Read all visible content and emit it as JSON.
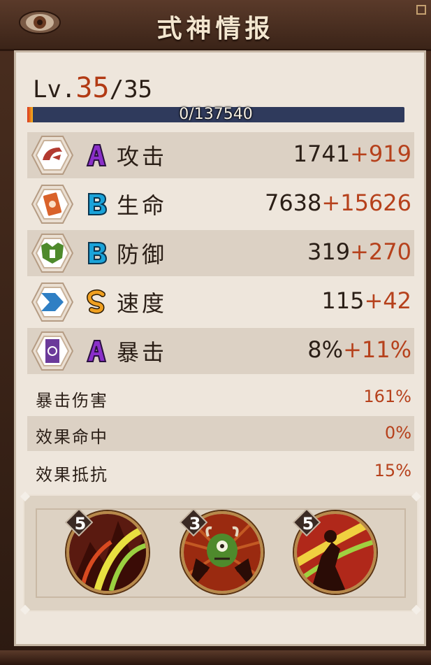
{
  "header": {
    "title": "式神情报"
  },
  "level": {
    "prefix": "Lv.",
    "current": "35",
    "max": "/35"
  },
  "xp": {
    "text": "0/137540",
    "fraction": 0
  },
  "stats": [
    {
      "name": "攻击",
      "grade": "A",
      "base": "1741",
      "bonus": "+919",
      "icon": "attack-icon"
    },
    {
      "name": "生命",
      "grade": "B",
      "base": "7638",
      "bonus": "+15626",
      "icon": "health-icon"
    },
    {
      "name": "防御",
      "grade": "B",
      "base": "319",
      "bonus": "+270",
      "icon": "defense-icon"
    },
    {
      "name": "速度",
      "grade": "S",
      "base": "115",
      "bonus": "+42",
      "icon": "speed-icon"
    },
    {
      "name": "暴击",
      "grade": "A",
      "base": "8%",
      "bonus": "+11%",
      "icon": "crit-icon"
    }
  ],
  "substats": [
    {
      "name": "暴击伤害",
      "value": "161%"
    },
    {
      "name": "效果命中",
      "value": "0%"
    },
    {
      "name": "效果抵抗",
      "value": "15%"
    }
  ],
  "skills": [
    {
      "level": "5",
      "icon": "skill-slash-icon"
    },
    {
      "level": "3",
      "icon": "skill-demon-icon"
    },
    {
      "level": "5",
      "icon": "skill-strike-icon"
    }
  ],
  "colors": {
    "bonus": "#b6411c",
    "level": "#b23a14",
    "gradeA": "#8a2fc9",
    "gradeB": "#1aa3d9",
    "gradeS": "#f0a020"
  }
}
